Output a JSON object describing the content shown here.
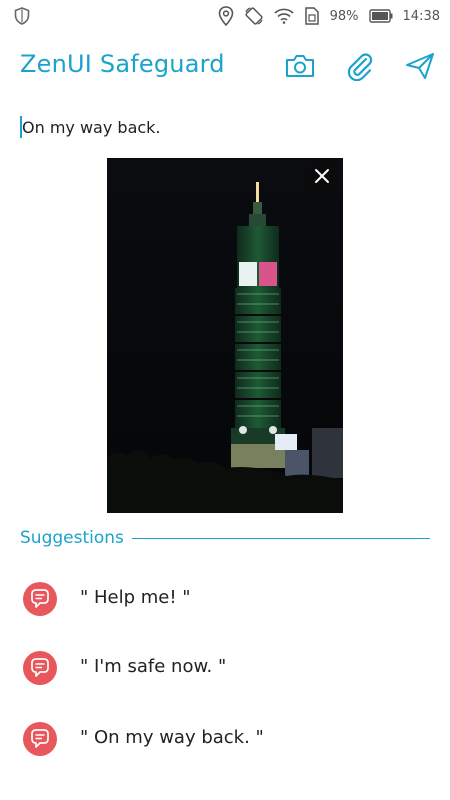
{
  "status_bar": {
    "battery_percent": "98%",
    "time": "14:38",
    "icons": [
      "shield-icon",
      "location-icon",
      "rotate-icon",
      "wifi-icon",
      "sim-icon",
      "battery-icon"
    ]
  },
  "app_bar": {
    "title": "ZenUI Safeguard",
    "actions": [
      "camera-icon",
      "attach-icon",
      "send-icon"
    ]
  },
  "message": {
    "text": "On my way back."
  },
  "attachment": {
    "type": "photo",
    "remove_icon": "close-icon"
  },
  "suggestions": {
    "title": "Suggestions",
    "items": [
      {
        "label": "\" Help me! \"",
        "icon": "chat-bubble-icon"
      },
      {
        "label": "\" I'm safe now. \"",
        "icon": "chat-bubble-icon"
      },
      {
        "label": "\" On my way back. \"",
        "icon": "chat-bubble-icon"
      }
    ]
  },
  "colors": {
    "accent": "#1ba3cc",
    "suggestion_icon": "#e8575c",
    "text": "#222222"
  }
}
